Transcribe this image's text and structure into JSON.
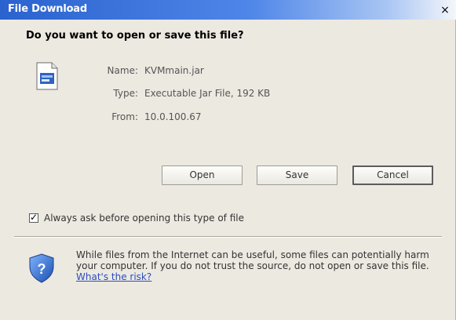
{
  "window": {
    "title": "File Download",
    "close_glyph": "×",
    "title_colors": {
      "start": "#2a62cf",
      "end": "#f4f6fb"
    }
  },
  "dialog": {
    "question": "Do you want to open or save this file?",
    "file_icon": "jar-file-icon",
    "name_label": "Name:",
    "name_value": "KVMmain.jar",
    "type_label": "Type:",
    "type_value": "Executable Jar File, 192 KB",
    "from_label": "From:",
    "from_value": "10.0.100.67"
  },
  "buttons": {
    "open": "Open",
    "save": "Save",
    "cancel": "Cancel"
  },
  "checkbox": {
    "checked": true,
    "label": "Always ask before opening this type of file"
  },
  "warning": {
    "icon": "shield-question-icon",
    "text": "While files from the Internet can be useful, some files can potentially harm your computer. If you do not trust the source, do not open or save this file.",
    "link_text": "What's the risk?"
  }
}
